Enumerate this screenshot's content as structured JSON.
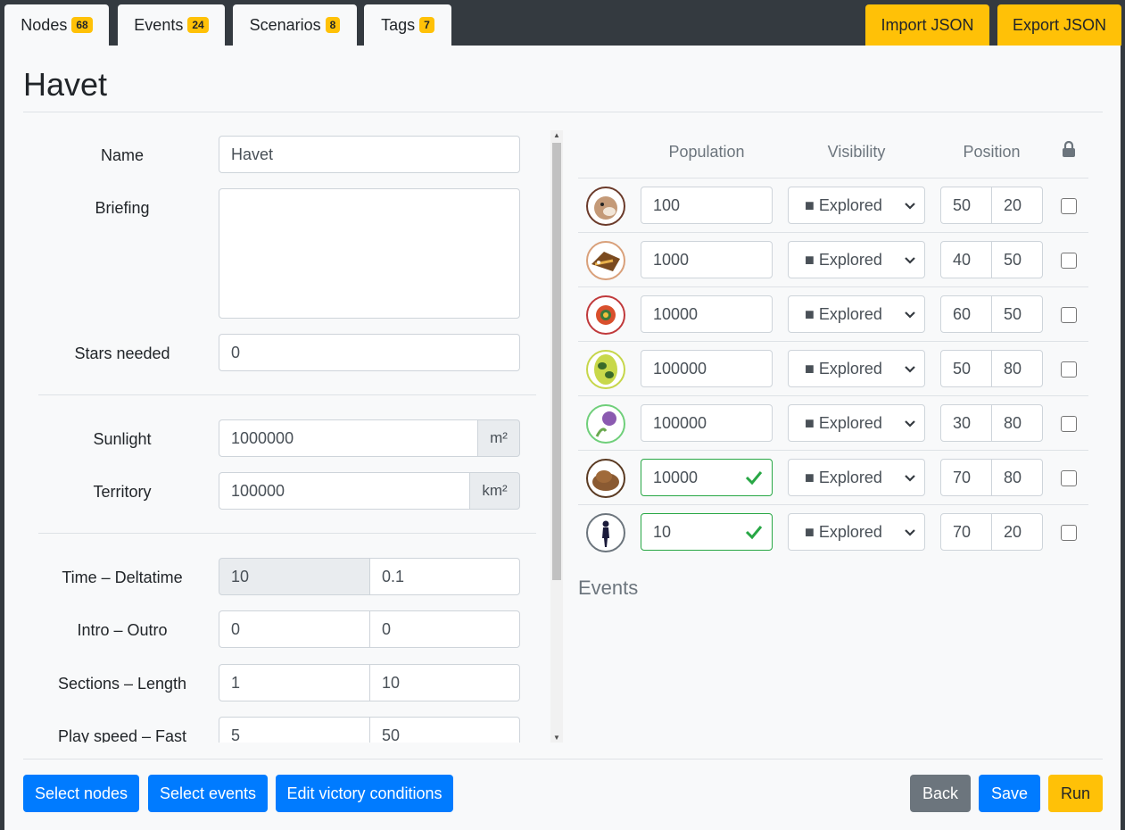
{
  "tabs": [
    {
      "label": "Nodes",
      "count": "68"
    },
    {
      "label": "Events",
      "count": "24"
    },
    {
      "label": "Scenarios",
      "count": "8"
    },
    {
      "label": "Tags",
      "count": "7"
    }
  ],
  "top_buttons": {
    "import": "Import JSON",
    "export": "Export JSON"
  },
  "title": "Havet",
  "form": {
    "name": {
      "label": "Name",
      "value": "Havet"
    },
    "briefing": {
      "label": "Briefing",
      "value": ""
    },
    "stars": {
      "label": "Stars needed",
      "value": "0"
    },
    "sunlight": {
      "label": "Sunlight",
      "value": "1000000",
      "unit": "m²"
    },
    "territory": {
      "label": "Territory",
      "value": "100000",
      "unit": "km²"
    },
    "time": {
      "label": "Time – Deltatime",
      "a": "10",
      "b": "0.1"
    },
    "intro": {
      "label": "Intro – Outro",
      "a": "0",
      "b": "0"
    },
    "sections": {
      "label": "Sections – Length",
      "a": "1",
      "b": "10"
    },
    "speed": {
      "label": "Play speed – Fast",
      "a": "5",
      "b": "50"
    }
  },
  "table": {
    "headers": {
      "population": "Population",
      "visibility": "Visibility",
      "position": "Position"
    },
    "rows": [
      {
        "icon": "otter-icon",
        "population": "100",
        "valid": false,
        "visibility": "■ Explored",
        "x": "50",
        "y": "20"
      },
      {
        "icon": "fish-icon",
        "population": "1000",
        "valid": false,
        "visibility": "■ Explored",
        "x": "40",
        "y": "50"
      },
      {
        "icon": "anemone-icon",
        "population": "10000",
        "valid": false,
        "visibility": "■ Explored",
        "x": "60",
        "y": "50"
      },
      {
        "icon": "seaweed-icon",
        "population": "100000",
        "valid": false,
        "visibility": "■ Explored",
        "x": "50",
        "y": "80"
      },
      {
        "icon": "algae-icon",
        "population": "100000",
        "valid": false,
        "visibility": "■ Explored",
        "x": "30",
        "y": "80"
      },
      {
        "icon": "rock-icon",
        "population": "10000",
        "valid": true,
        "visibility": "■ Explored",
        "x": "70",
        "y": "80"
      },
      {
        "icon": "human-icon",
        "population": "10",
        "valid": true,
        "visibility": "■ Explored",
        "x": "70",
        "y": "20"
      }
    ]
  },
  "events_heading": "Events",
  "bottom": {
    "select_nodes": "Select nodes",
    "select_events": "Select events",
    "edit_victory": "Edit victory conditions",
    "back": "Back",
    "save": "Save",
    "run": "Run"
  },
  "colors": {
    "accent_yellow": "#ffc107",
    "primary": "#007bff",
    "success": "#28a745",
    "dark": "#343a40"
  }
}
